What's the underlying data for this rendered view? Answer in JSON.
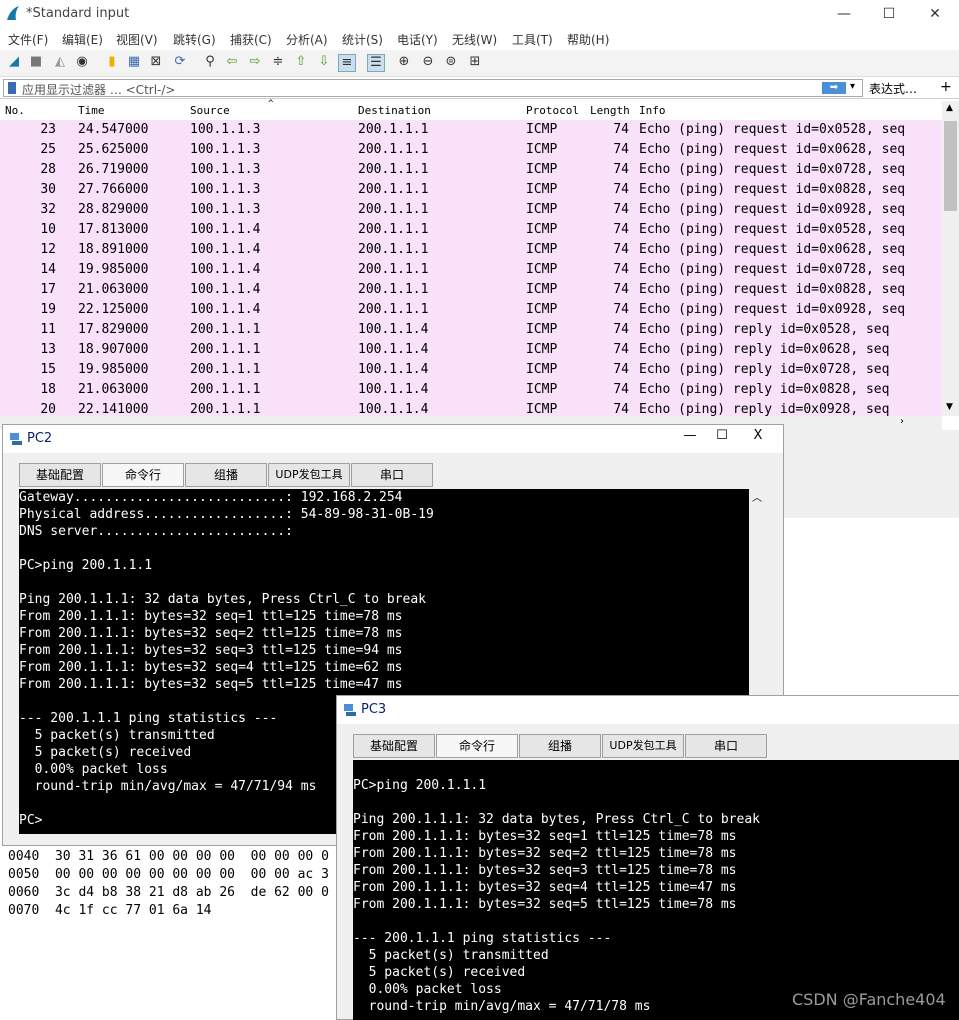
{
  "wireshark": {
    "title": "*Standard input",
    "menu": [
      "文件(F)",
      "编辑(E)",
      "视图(V)",
      "跳转(G)",
      "捕获(C)",
      "分析(A)",
      "统计(S)",
      "电话(Y)",
      "无线(W)",
      "工具(T)",
      "帮助(H)"
    ],
    "filter_placeholder": "应用显示过滤器 … <Ctrl-/>",
    "expression_label": "表达式…",
    "plus_label": "+",
    "columns": [
      "No.",
      "Time",
      "Source",
      "Destination",
      "Protocol",
      "Length",
      "Info"
    ],
    "packets": [
      {
        "no": "23",
        "time": "24.547000",
        "src": "100.1.1.3",
        "dst": "200.1.1.1",
        "proto": "ICMP",
        "len": "74",
        "info": "Echo (ping) request  id=0x0528, seq"
      },
      {
        "no": "25",
        "time": "25.625000",
        "src": "100.1.1.3",
        "dst": "200.1.1.1",
        "proto": "ICMP",
        "len": "74",
        "info": "Echo (ping) request  id=0x0628, seq"
      },
      {
        "no": "28",
        "time": "26.719000",
        "src": "100.1.1.3",
        "dst": "200.1.1.1",
        "proto": "ICMP",
        "len": "74",
        "info": "Echo (ping) request  id=0x0728, seq"
      },
      {
        "no": "30",
        "time": "27.766000",
        "src": "100.1.1.3",
        "dst": "200.1.1.1",
        "proto": "ICMP",
        "len": "74",
        "info": "Echo (ping) request  id=0x0828, seq"
      },
      {
        "no": "32",
        "time": "28.829000",
        "src": "100.1.1.3",
        "dst": "200.1.1.1",
        "proto": "ICMP",
        "len": "74",
        "info": "Echo (ping) request  id=0x0928, seq"
      },
      {
        "no": "10",
        "time": "17.813000",
        "src": "100.1.1.4",
        "dst": "200.1.1.1",
        "proto": "ICMP",
        "len": "74",
        "info": "Echo (ping) request  id=0x0528, seq"
      },
      {
        "no": "12",
        "time": "18.891000",
        "src": "100.1.1.4",
        "dst": "200.1.1.1",
        "proto": "ICMP",
        "len": "74",
        "info": "Echo (ping) request  id=0x0628, seq"
      },
      {
        "no": "14",
        "time": "19.985000",
        "src": "100.1.1.4",
        "dst": "200.1.1.1",
        "proto": "ICMP",
        "len": "74",
        "info": "Echo (ping) request  id=0x0728, seq"
      },
      {
        "no": "17",
        "time": "21.063000",
        "src": "100.1.1.4",
        "dst": "200.1.1.1",
        "proto": "ICMP",
        "len": "74",
        "info": "Echo (ping) request  id=0x0828, seq"
      },
      {
        "no": "19",
        "time": "22.125000",
        "src": "100.1.1.4",
        "dst": "200.1.1.1",
        "proto": "ICMP",
        "len": "74",
        "info": "Echo (ping) request  id=0x0928, seq"
      },
      {
        "no": "11",
        "time": "17.829000",
        "src": "200.1.1.1",
        "dst": "100.1.1.4",
        "proto": "ICMP",
        "len": "74",
        "info": "Echo (ping) reply    id=0x0528, seq"
      },
      {
        "no": "13",
        "time": "18.907000",
        "src": "200.1.1.1",
        "dst": "100.1.1.4",
        "proto": "ICMP",
        "len": "74",
        "info": "Echo (ping) reply    id=0x0628, seq"
      },
      {
        "no": "15",
        "time": "19.985000",
        "src": "200.1.1.1",
        "dst": "100.1.1.4",
        "proto": "ICMP",
        "len": "74",
        "info": "Echo (ping) reply    id=0x0728, seq"
      },
      {
        "no": "18",
        "time": "21.063000",
        "src": "200.1.1.1",
        "dst": "100.1.1.4",
        "proto": "ICMP",
        "len": "74",
        "info": "Echo (ping) reply    id=0x0828, seq"
      },
      {
        "no": "20",
        "time": "22.141000",
        "src": "200.1.1.1",
        "dst": "100.1.1.4",
        "proto": "ICMP",
        "len": "74",
        "info": "Echo (ping) reply    id=0x0928, seq"
      }
    ],
    "hex_lines": [
      "0040  30 31 36 61 00 00 00 00  00 00 00 0",
      "0050  00 00 00 00 00 00 00 00  00 00 ac 3",
      "0060  3c d4 b8 38 21 d8 ab 26  de 62 00 0",
      "0070  4c 1f cc 77 01 6a 14"
    ],
    "row_color": "#fae1fa"
  },
  "pc2": {
    "title": "PC2",
    "tabs": [
      "基础配置",
      "命令行",
      "组播",
      "UDP发包工具",
      "串口"
    ],
    "active_tab": 1,
    "lines": [
      "Gateway...........................: 192.168.2.254",
      "Physical address..................: 54-89-98-31-0B-19",
      "DNS server........................:",
      "",
      "PC>ping 200.1.1.1",
      "",
      "Ping 200.1.1.1: 32 data bytes, Press Ctrl_C to break",
      "From 200.1.1.1: bytes=32 seq=1 ttl=125 time=78 ms",
      "From 200.1.1.1: bytes=32 seq=2 ttl=125 time=78 ms",
      "From 200.1.1.1: bytes=32 seq=3 ttl=125 time=94 ms",
      "From 200.1.1.1: bytes=32 seq=4 ttl=125 time=62 ms",
      "From 200.1.1.1: bytes=32 seq=5 ttl=125 time=47 ms",
      "",
      "--- 200.1.1.1 ping statistics ---",
      "  5 packet(s) transmitted",
      "  5 packet(s) received",
      "  0.00% packet loss",
      "  round-trip min/avg/max = 47/71/94 ms",
      "",
      "PC>"
    ]
  },
  "pc3": {
    "title": "PC3",
    "tabs": [
      "基础配置",
      "命令行",
      "组播",
      "UDP发包工具",
      "串口"
    ],
    "active_tab": 1,
    "lines": [
      "",
      "PC>ping 200.1.1.1",
      "",
      "Ping 200.1.1.1: 32 data bytes, Press Ctrl_C to break",
      "From 200.1.1.1: bytes=32 seq=1 ttl=125 time=78 ms",
      "From 200.1.1.1: bytes=32 seq=2 ttl=125 time=78 ms",
      "From 200.1.1.1: bytes=32 seq=3 ttl=125 time=78 ms",
      "From 200.1.1.1: bytes=32 seq=4 ttl=125 time=47 ms",
      "From 200.1.1.1: bytes=32 seq=5 ttl=125 time=78 ms",
      "",
      "--- 200.1.1.1 ping statistics ---",
      "  5 packet(s) transmitted",
      "  5 packet(s) received",
      "  0.00% packet loss",
      "  round-trip min/avg/max = 47/71/78 ms"
    ]
  },
  "watermark": "CSDN @Fanche404"
}
